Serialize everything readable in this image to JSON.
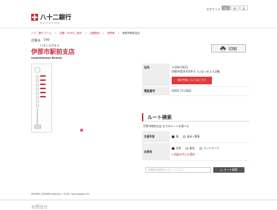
{
  "header": {
    "logo_text": "八十二銀行",
    "logo_sub": "Bank branch guide"
  },
  "font_size": {
    "label": "文字サイズ",
    "small": "小",
    "medium": "中",
    "large": "大"
  },
  "breadcrumb": [
    "八十二銀行 ホーム",
    "店舗・ATMのご案内",
    "店舗検索",
    "長野県",
    "伊那市駅前支店"
  ],
  "branch": {
    "no_label": "店番号",
    "no_value": "590",
    "kana": "いなしえきまえ",
    "name": "伊那市駅前支店",
    "name_en": "Inashiekimae Branch"
  },
  "print_label": "印刷",
  "info": {
    "address_label": "住所",
    "postal": "〒396-0025",
    "address": "伊那市荒井3500-1（いなっせビル2階）",
    "reserve_label": "来店予約についてはこちら",
    "phone_label": "電話番号",
    "phone": "0265-73-2082"
  },
  "route": {
    "heading": "ルート検索",
    "description": "伊那市駅前支店 までのルートを調べる",
    "transport_label": "交通手段",
    "transport_options": [
      "車",
      "徒歩+電車"
    ],
    "origin_label": "出発地",
    "origin_options": [
      "住所",
      "駅名",
      "ランドマーク"
    ],
    "map_link": "地図の中心を選択",
    "input_placeholder": "出発地の住所を入力してください",
    "search_label": "ルート検索"
  },
  "copyright": "ZENRIN / ZENRIN DataCom / ©ZDC Technologies Inc.",
  "footer_text": "お問合せ"
}
